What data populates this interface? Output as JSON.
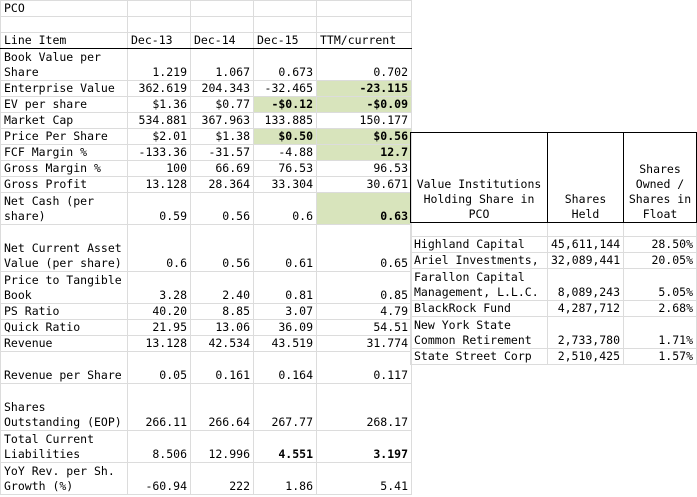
{
  "sheet_title": "PCO",
  "headers": [
    "Line Item",
    "Dec-13",
    "Dec-14",
    "Dec-15",
    "TTM/current"
  ],
  "rows": [
    {
      "label": "Book Value per\nShare",
      "values": [
        "1.219",
        "1.067",
        "0.673",
        "0.702"
      ],
      "highlight": [
        false,
        false,
        false,
        false
      ],
      "bold": [
        false,
        false,
        false,
        false
      ],
      "lines": 2
    },
    {
      "label": "Enterprise Value",
      "values": [
        "362.619",
        "204.343",
        "-32.465",
        "-23.115"
      ],
      "highlight": [
        false,
        false,
        false,
        true
      ],
      "bold": [
        false,
        false,
        false,
        true
      ],
      "lines": 1
    },
    {
      "label": "EV per share",
      "values": [
        "$1.36",
        "$0.77",
        "-$0.12",
        "-$0.09"
      ],
      "highlight": [
        false,
        false,
        true,
        true
      ],
      "bold": [
        false,
        false,
        true,
        true
      ],
      "lines": 1
    },
    {
      "label": "Market Cap",
      "values": [
        "534.881",
        "367.963",
        "133.885",
        "150.177"
      ],
      "highlight": [
        false,
        false,
        false,
        false
      ],
      "bold": [
        false,
        false,
        false,
        false
      ],
      "lines": 1
    },
    {
      "label": "Price Per Share",
      "values": [
        "$2.01",
        "$1.38",
        "$0.50",
        "$0.56"
      ],
      "highlight": [
        false,
        false,
        true,
        true
      ],
      "bold": [
        false,
        false,
        true,
        true
      ],
      "lines": 1
    },
    {
      "label": "FCF Margin %",
      "values": [
        "-133.36",
        "-31.57",
        "-4.88",
        "12.7"
      ],
      "highlight": [
        false,
        false,
        false,
        true
      ],
      "bold": [
        false,
        false,
        false,
        true
      ],
      "lines": 1
    },
    {
      "label": "Gross Margin %",
      "values": [
        "100",
        "66.69",
        "76.53",
        "96.53"
      ],
      "highlight": [
        false,
        false,
        false,
        false
      ],
      "bold": [
        false,
        false,
        false,
        false
      ],
      "lines": 1
    },
    {
      "label": "Gross Profit",
      "values": [
        "13.128",
        "28.364",
        "33.304",
        "30.671"
      ],
      "highlight": [
        false,
        false,
        false,
        false
      ],
      "bold": [
        false,
        false,
        false,
        false
      ],
      "lines": 1
    },
    {
      "label": "Net Cash (per\nshare)",
      "values": [
        "0.59",
        "0.56",
        "0.6",
        "0.63"
      ],
      "highlight": [
        false,
        false,
        false,
        true
      ],
      "bold": [
        false,
        false,
        false,
        true
      ],
      "lines": 2
    },
    {
      "label": "Net Current Asset\nValue (per share)",
      "values": [
        "0.6",
        "0.56",
        "0.61",
        "0.65"
      ],
      "highlight": [
        false,
        false,
        false,
        false
      ],
      "bold": [
        false,
        false,
        false,
        false
      ],
      "lines": 3
    },
    {
      "label": "Price to Tangible\nBook",
      "values": [
        "3.28",
        "2.40",
        "0.81",
        "0.85"
      ],
      "highlight": [
        false,
        false,
        false,
        false
      ],
      "bold": [
        false,
        false,
        false,
        false
      ],
      "lines": 2
    },
    {
      "label": "PS Ratio",
      "values": [
        "40.20",
        "8.85",
        "3.07",
        "4.79"
      ],
      "highlight": [
        false,
        false,
        false,
        false
      ],
      "bold": [
        false,
        false,
        false,
        false
      ],
      "lines": 1
    },
    {
      "label": "Quick Ratio",
      "values": [
        "21.95",
        "13.06",
        "36.09",
        "54.51"
      ],
      "highlight": [
        false,
        false,
        false,
        false
      ],
      "bold": [
        false,
        false,
        false,
        false
      ],
      "lines": 1
    },
    {
      "label": "Revenue",
      "values": [
        "13.128",
        "42.534",
        "43.519",
        "31.774"
      ],
      "highlight": [
        false,
        false,
        false,
        false
      ],
      "bold": [
        false,
        false,
        false,
        false
      ],
      "lines": 1
    },
    {
      "label": "Revenue per Share",
      "values": [
        "0.05",
        "0.161",
        "0.164",
        "0.117"
      ],
      "highlight": [
        false,
        false,
        false,
        false
      ],
      "bold": [
        false,
        false,
        false,
        false
      ],
      "lines": 2
    },
    {
      "label": "Shares\nOutstanding (EOP)",
      "values": [
        "266.11",
        "266.64",
        "267.77",
        "268.17"
      ],
      "highlight": [
        false,
        false,
        false,
        false
      ],
      "bold": [
        false,
        false,
        false,
        false
      ],
      "lines": 3
    },
    {
      "label": "Total Current\nLiabilities",
      "values": [
        "8.506",
        "12.996",
        "4.551",
        "3.197"
      ],
      "highlight": [
        false,
        false,
        false,
        false
      ],
      "bold": [
        false,
        false,
        true,
        true
      ],
      "lines": 2
    },
    {
      "label": "YoY Rev. per Sh.\nGrowth (%)",
      "values": [
        "-60.94",
        "222",
        "1.86",
        "5.41"
      ],
      "highlight": [
        false,
        false,
        false,
        false
      ],
      "bold": [
        false,
        false,
        false,
        false
      ],
      "lines": 2
    }
  ],
  "institutions": {
    "headers": [
      "Value Institutions\nHolding Share in\nPCO",
      "Shares\nHeld",
      "Shares\nOwned /\nShares in\nFloat"
    ],
    "rows": [
      {
        "name": "Highland Capital",
        "shares": "45,611,144",
        "pct": "28.50%",
        "lines": 1
      },
      {
        "name": "Ariel Investments,",
        "shares": "32,089,441",
        "pct": "20.05%",
        "lines": 1
      },
      {
        "name": "Farallon Capital\nManagement, L.L.C.",
        "shares": "8,089,243",
        "pct": "5.05%",
        "lines": 2
      },
      {
        "name": "BlackRock Fund",
        "shares": "4,287,712",
        "pct": "2.68%",
        "lines": 1
      },
      {
        "name": "New York State\nCommon Retirement",
        "shares": "2,733,780",
        "pct": "1.71%",
        "lines": 2
      },
      {
        "name": "State Street Corp",
        "shares": "2,510,425",
        "pct": "1.57%",
        "lines": 1
      }
    ]
  },
  "colors": {
    "highlight": "#d8e4bc",
    "grid": "#dcdcdc"
  }
}
